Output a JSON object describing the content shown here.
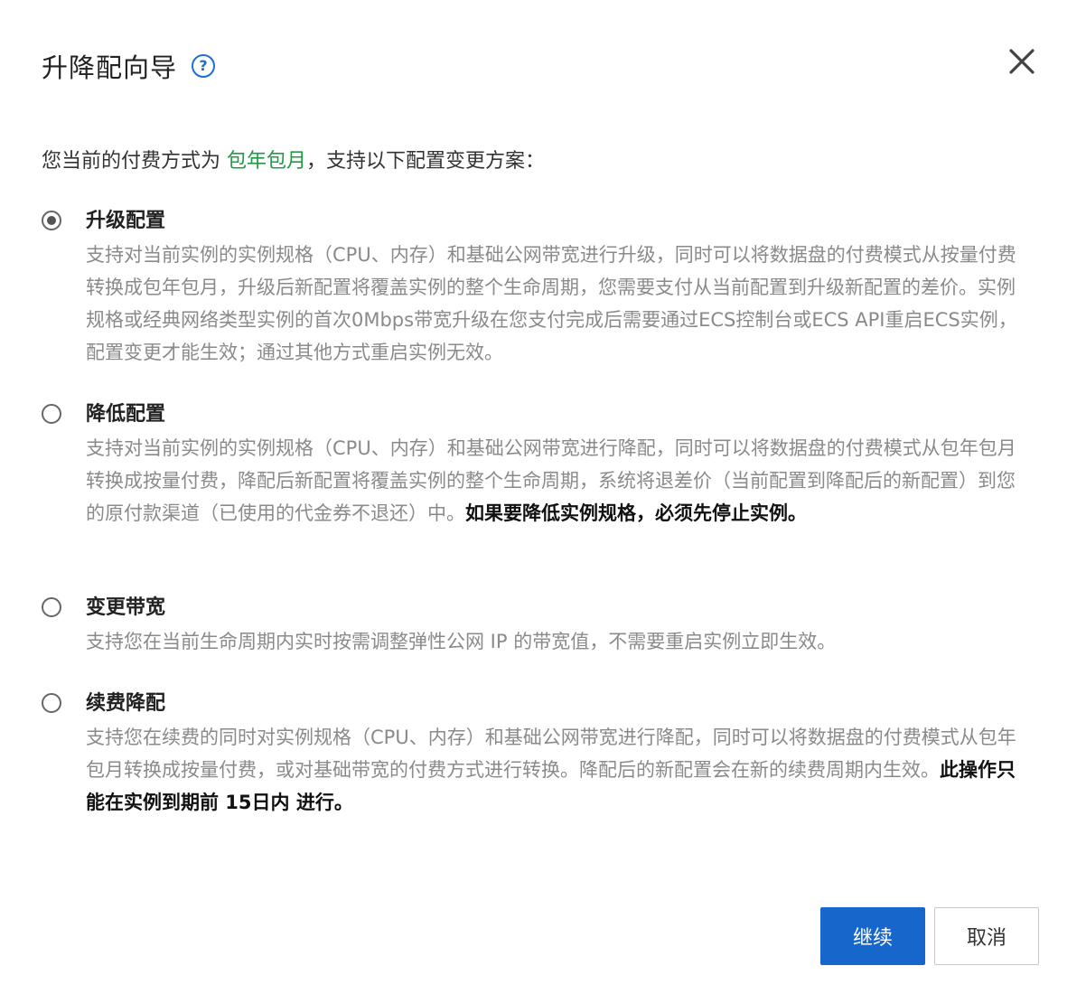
{
  "dialog": {
    "title": "升降配向导",
    "help_icon": "question-circle-icon",
    "close_icon": "close-icon"
  },
  "intro": {
    "prefix": "您当前的付费方式为 ",
    "payment_type": "包年包月",
    "suffix": "，支持以下配置变更方案："
  },
  "options": [
    {
      "title": "升级配置",
      "checked": true,
      "desc": "支持对当前实例的实例规格（CPU、内存）和基础公网带宽进行升级，同时可以将数据盘的付费模式从按量付费转换成包年包月，升级后新配置将覆盖实例的整个生命周期，您需要支付从当前配置到升级新配置的差价。实例规格或经典网络类型实例的首次0Mbps带宽升级在您支付完成后需要通过ECS控制台或ECS API重启ECS实例，配置变更才能生效；通过其他方式重启实例无效。",
      "desc_bold": ""
    },
    {
      "title": "降低配置",
      "checked": false,
      "desc": "支持对当前实例的实例规格（CPU、内存）和基础公网带宽进行降配，同时可以将数据盘的付费模式从包年包月转换成按量付费，降配后新配置将覆盖实例的整个生命周期，系统将退差价（当前配置到降配后的新配置）到您的原付款渠道（已使用的代金券不退还）中。",
      "desc_bold": "如果要降低实例规格，必须先停止实例。"
    },
    {
      "title": "变更带宽",
      "checked": false,
      "desc": "支持您在当前生命周期内实时按需调整弹性公网 IP 的带宽值，不需要重启实例立即生效。",
      "desc_bold": ""
    },
    {
      "title": "续费降配",
      "checked": false,
      "desc": "支持您在续费的同时对实例规格（CPU、内存）和基础公网带宽进行降配，同时可以将数据盘的付费模式从包年包月转换成按量付费，或对基础带宽的付费方式进行转换。降配后的新配置会在新的续费周期内生效。",
      "desc_bold": "此操作只能在实例到期前 15日内 进行。"
    }
  ],
  "footer": {
    "continue_label": "继续",
    "cancel_label": "取消"
  },
  "colors": {
    "primary": "#1766cc",
    "highlight": "#1f9b44",
    "help": "#1d6fd8"
  }
}
